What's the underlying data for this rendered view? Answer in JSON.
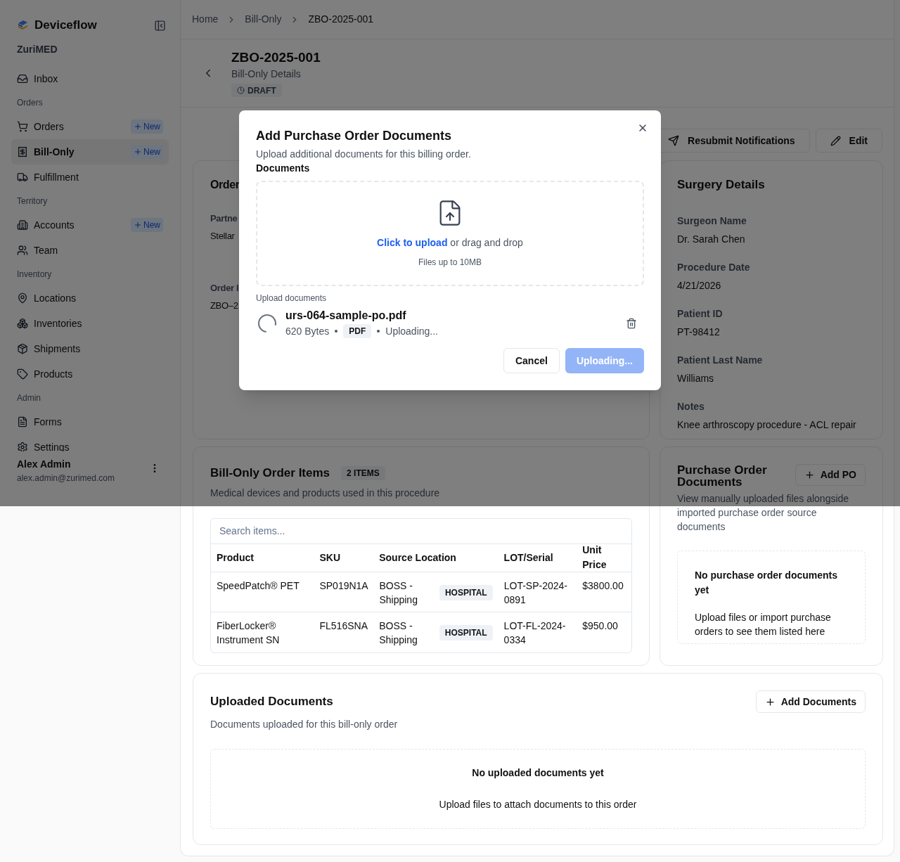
{
  "sidebar": {
    "brand": "Deviceflow",
    "org": "ZuriMED",
    "sections": [
      {
        "items": [
          {
            "label": "Inbox",
            "selected": false
          }
        ]
      },
      {
        "heading": "Orders",
        "items": [
          {
            "label": "Orders",
            "selected": false,
            "badge": "New"
          },
          {
            "label": "Bill-Only",
            "selected": true,
            "badge": "New"
          },
          {
            "label": "Fulfillment",
            "selected": false
          }
        ]
      },
      {
        "heading": "Territory",
        "items": [
          {
            "label": "Accounts",
            "selected": false,
            "badge": "New"
          },
          {
            "label": "Team",
            "selected": false
          }
        ]
      },
      {
        "heading": "Inventory",
        "items": [
          {
            "label": "Locations",
            "selected": false
          },
          {
            "label": "Inventories",
            "selected": false
          },
          {
            "label": "Shipments",
            "selected": false
          },
          {
            "label": "Products",
            "selected": false
          }
        ]
      },
      {
        "heading": "Admin",
        "items": [
          {
            "label": "Forms",
            "selected": false
          },
          {
            "label": "Settings",
            "selected": false
          }
        ]
      }
    ],
    "user": {
      "name": "Alex Admin",
      "email": "alex.admin@zurimed.com"
    }
  },
  "breadcrumbs": [
    "Home",
    "Bill-Only",
    "ZBO-2025-001"
  ],
  "header": {
    "title": "ZBO-2025-001",
    "subtitle": "Bill-Only Details",
    "status": "DRAFT"
  },
  "actions": [
    "Resubmit Notifications",
    "Edit"
  ],
  "order_card": {
    "title": "Order",
    "fields": [
      {
        "label": "Partne",
        "value": "Stellar"
      },
      {
        "label": "Order I",
        "value": "ZBO–2"
      }
    ]
  },
  "surgery_card": {
    "title": "Surgery Details",
    "fields": [
      {
        "label": "Surgeon Name",
        "value": "Dr. Sarah Chen"
      },
      {
        "label": "Procedure Date",
        "value": "4/21/2026"
      },
      {
        "label": "Patient ID",
        "value": "PT-98412"
      },
      {
        "label": "Patient Last Name",
        "value": "Williams"
      },
      {
        "label": "Notes",
        "value": "Knee arthroscopy procedure - ACL repair"
      }
    ]
  },
  "items_card": {
    "title": "Bill-Only Order Items",
    "count": "2 ITEMS",
    "description": "Medical devices and products used in this procedure",
    "search": {
      "placeholder": "Search items..."
    },
    "columns": [
      "Product",
      "SKU",
      "Source Location",
      "LOT/Serial",
      "Unit Price"
    ],
    "rows": [
      {
        "product": "SpeedPatch® PET",
        "sku": "SP019N1A",
        "source": "BOSS - Shipping",
        "source_tag": "HOSPITAL",
        "lot": "LOT-SP-2024-0891",
        "price": "$3800.00"
      },
      {
        "product": "FiberLocker® Instrument SN",
        "sku": "FL516SNA",
        "source": "BOSS - Shipping",
        "source_tag": "HOSPITAL",
        "lot": "LOT-FL-2024-0334",
        "price": "$950.00"
      }
    ]
  },
  "po_card": {
    "title": "Purchase Order Documents",
    "button": "Add PO",
    "description": "View manually uploaded files alongside imported purchase order source documents",
    "empty_title": "No purchase order documents yet",
    "empty_text": "Upload files or import purchase orders to see them listed here"
  },
  "uploaded_card": {
    "title": "Uploaded Documents",
    "button": "Add Documents",
    "description": "Documents uploaded for this bill-only order",
    "empty_title": "No uploaded documents yet",
    "empty_text": "Upload files to attach documents to this order"
  },
  "modal": {
    "title": "Add Purchase Order Documents",
    "description": "Upload additional documents for this billing order.",
    "field_label": "Documents",
    "dropzone": {
      "link": "Click to upload",
      "text": "or drag and drop",
      "hint": "Files up to 10MB"
    },
    "list_label": "Upload documents",
    "files": [
      {
        "name": "urs-064-sample-po.pdf",
        "size": "620 Bytes",
        "type": "PDF",
        "status": "Uploading...",
        "uploading": true
      }
    ],
    "buttons": [
      {
        "label": "Cancel",
        "kind": "secondary",
        "disabled": false
      },
      {
        "label": "Uploading...",
        "kind": "primary",
        "disabled": true
      }
    ]
  }
}
